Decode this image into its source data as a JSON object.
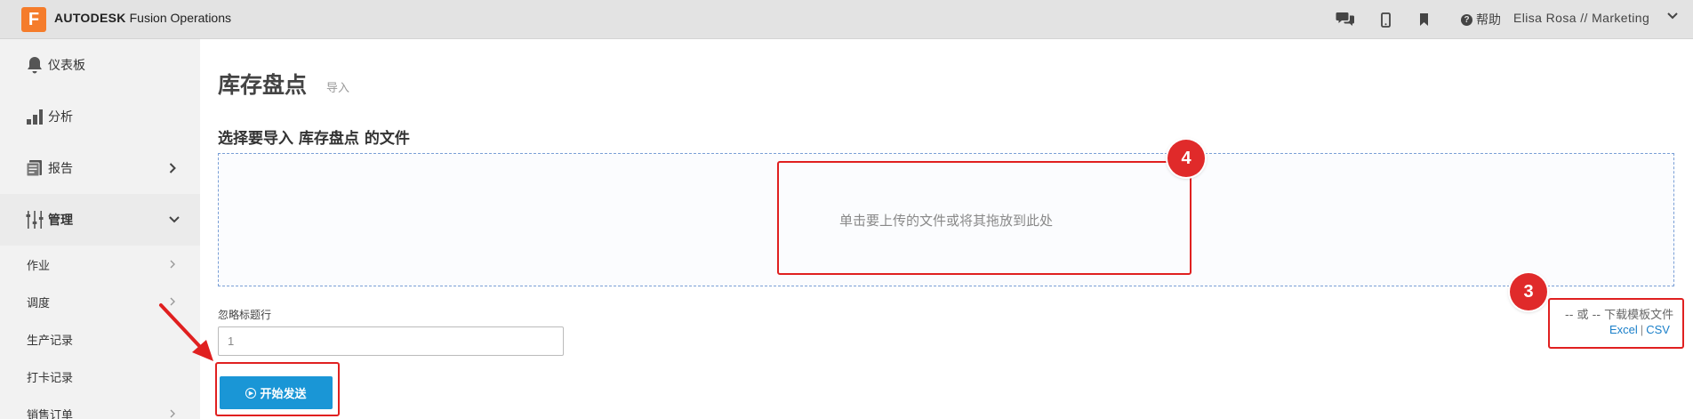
{
  "app": {
    "logo_letter": "F",
    "brand": "AUTODESK",
    "product": "Fusion Operations"
  },
  "topbar": {
    "help_label": "帮助",
    "user_label": "Elisa Rosa // Marketing"
  },
  "sidebar": {
    "items": [
      {
        "label": "仪表板",
        "icon": "bell-icon"
      },
      {
        "label": "分析",
        "icon": "bar-chart-icon"
      },
      {
        "label": "报告",
        "icon": "report-icon"
      },
      {
        "label": "管理",
        "icon": "sliders-icon"
      }
    ],
    "subitems": [
      {
        "label": "作业"
      },
      {
        "label": "调度"
      },
      {
        "label": "生产记录"
      },
      {
        "label": "打卡记录"
      },
      {
        "label": "销售订单"
      }
    ]
  },
  "main": {
    "title": "库存盘点",
    "subtitle": "导入",
    "section_title": "选择要导入 库存盘点 的文件",
    "dropzone_text": "单击要上传的文件或将其拖放到此处",
    "skip_label": "忽略标题行",
    "skip_value": "1",
    "send_label": "开始发送",
    "or_text": "-- 或 -- 下载模板文件",
    "excel_label": "Excel",
    "csv_label": "CSV"
  },
  "annotations": {
    "badge_dropzone": "4",
    "badge_download": "3"
  },
  "colors": {
    "accent_orange": "#f57c2b",
    "button_blue": "#1a96d6",
    "link_blue": "#1a7fc9",
    "annotation_red": "#e02020"
  }
}
